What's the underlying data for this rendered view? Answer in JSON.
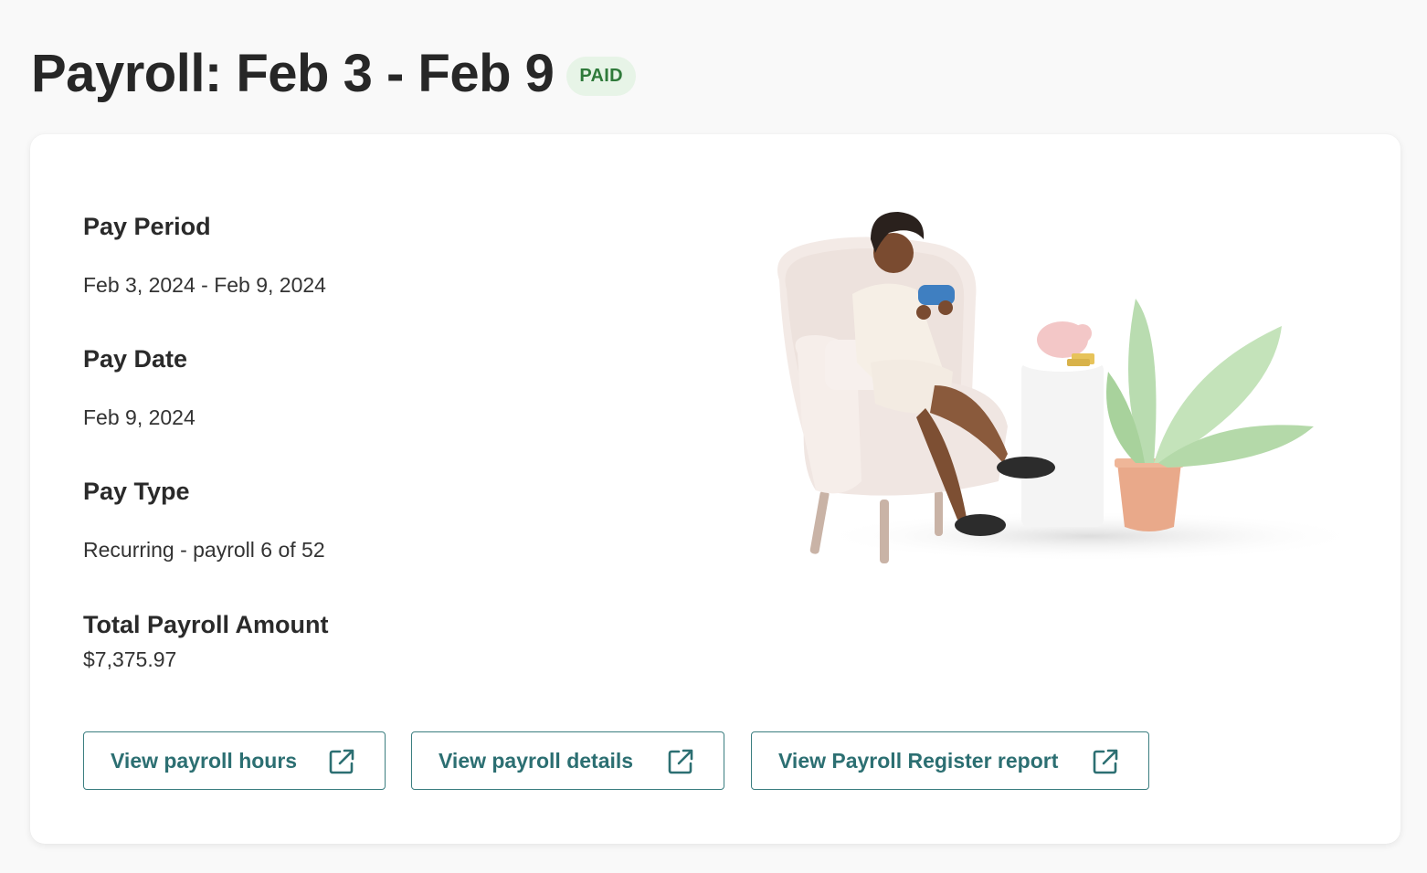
{
  "header": {
    "title": "Payroll: Feb 3 - Feb 9",
    "status": "PAID"
  },
  "details": {
    "pay_period_label": "Pay Period",
    "pay_period_value": "Feb 3, 2024 - Feb 9, 2024",
    "pay_date_label": "Pay Date",
    "pay_date_value": "Feb 9, 2024",
    "pay_type_label": "Pay Type",
    "pay_type_value": "Recurring - payroll 6 of 52",
    "total_label": "Total Payroll Amount",
    "total_value": "$7,375.97"
  },
  "actions": {
    "hours_label": "View payroll hours",
    "details_label": "View payroll details",
    "register_label": "View Payroll Register report",
    "icon": "external-link-icon"
  },
  "colors": {
    "accent": "#2c6f72",
    "badge_bg": "#e7f4e7",
    "badge_text": "#2f7a3a"
  }
}
